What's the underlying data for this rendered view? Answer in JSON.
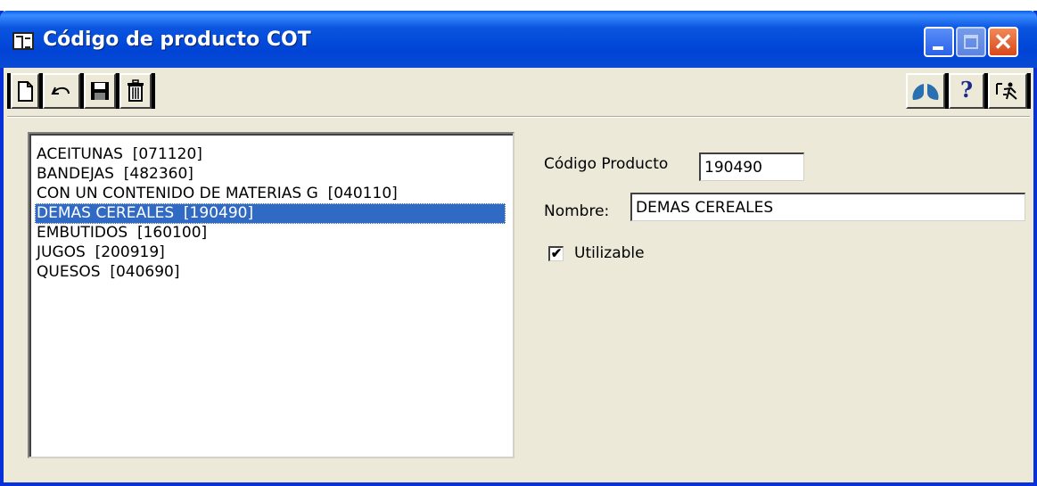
{
  "window": {
    "title": "Código de producto COT",
    "close_glyph": "✕"
  },
  "toolbar": {
    "left_buttons": [
      "new-icon",
      "undo-icon",
      "save-icon",
      "delete-icon"
    ],
    "right_buttons": [
      "lungs-icon",
      "help-icon",
      "exit-icon"
    ],
    "help_glyph": "?"
  },
  "product_list": {
    "items": [
      "ACEITUNAS  [071120]",
      "BANDEJAS  [482360]",
      "CON UN CONTENIDO DE MATERIAS G  [040110]",
      "DEMAS CEREALES  [190490]",
      "EMBUTIDOS  [160100]",
      "JUGOS  [200919]",
      "QUESOS  [040690]"
    ],
    "selected_index": 3
  },
  "form": {
    "codigo_label": "Código Producto",
    "codigo_value": "190490",
    "nombre_label": "Nombre:",
    "nombre_value": "DEMAS CEREALES",
    "utilizable_label": "Utilizable",
    "utilizable_checked": true,
    "check_glyph": "✔"
  },
  "colors": {
    "selection": "#316ac5",
    "titlebar": "#0a55e0",
    "background": "#ece9d8"
  }
}
